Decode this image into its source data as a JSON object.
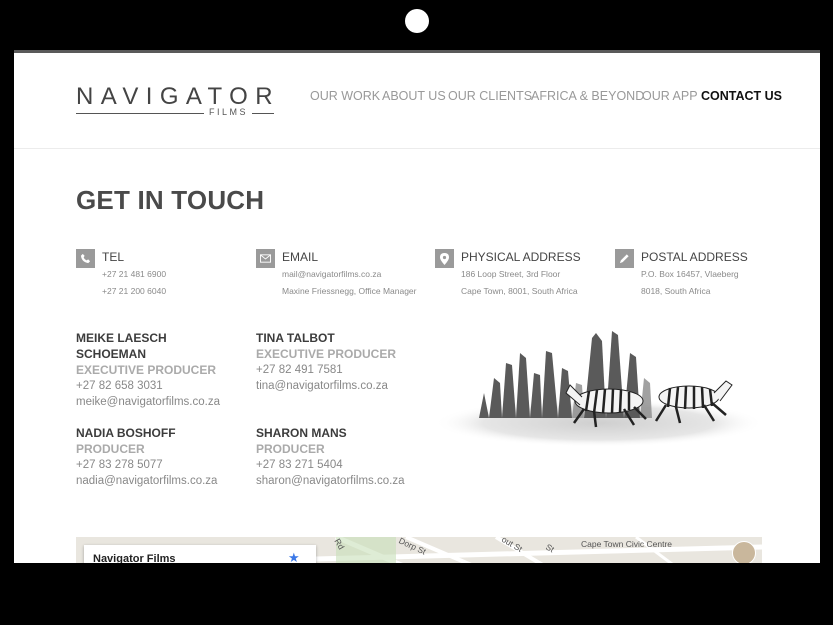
{
  "brand": {
    "name": "NAVIGATOR",
    "sub": "FILMS"
  },
  "nav": [
    {
      "label": "OUR WORK"
    },
    {
      "label": "ABOUT US"
    },
    {
      "label": "OUR CLIENTS"
    },
    {
      "label": "AFRICA & BEYOND"
    },
    {
      "label": "OUR APP"
    },
    {
      "label": "CONTACT US",
      "active": true
    }
  ],
  "page": {
    "title": "GET IN TOUCH"
  },
  "info": {
    "tel": {
      "label": "TEL",
      "icon": "phone-icon",
      "lines": [
        "+27 21 481 6900",
        "+27 21 200 6040"
      ]
    },
    "email": {
      "label": "EMAIL",
      "icon": "envelope-icon",
      "lines": [
        "mail@navigatorfilms.co.za",
        "Maxine Friessnegg, Office Manager"
      ]
    },
    "physical": {
      "label": "PHYSICAL ADDRESS",
      "icon": "map-pin-icon",
      "lines": [
        "186 Loop Street, 3rd Floor",
        "Cape Town, 8001, South Africa"
      ]
    },
    "postal": {
      "label": "POSTAL ADDRESS",
      "icon": "pencil-icon",
      "lines": [
        "P.O. Box 16457, Vlaeberg",
        "8018, South Africa"
      ]
    }
  },
  "contacts": [
    {
      "name_line1": "MEIKE LAESCH",
      "name_line2": "SCHOEMAN",
      "role": "EXECUTIVE PRODUCER",
      "phone": "+27 82 658 3031",
      "email": "meike@navigatorfilms.co.za"
    },
    {
      "name_line1": "TINA TALBOT",
      "role": "EXECUTIVE PRODUCER",
      "phone": "+27 82 491 7581",
      "email": "tina@navigatorfilms.co.za"
    },
    {
      "name_line1": "NADIA BOSHOFF",
      "role": "PRODUCER",
      "phone": "+27 83 278 5077",
      "email": "nadia@navigatorfilms.co.za"
    },
    {
      "name_line1": "SHARON MANS",
      "role": "PRODUCER",
      "phone": "+27 83 271 5404",
      "email": "sharon@navigatorfilms.co.za"
    }
  ],
  "map": {
    "place_title": "Navigator Films",
    "labels": [
      "Cape Town Civic Centre",
      "Dorp St",
      "Rd",
      "out St",
      "St"
    ]
  }
}
